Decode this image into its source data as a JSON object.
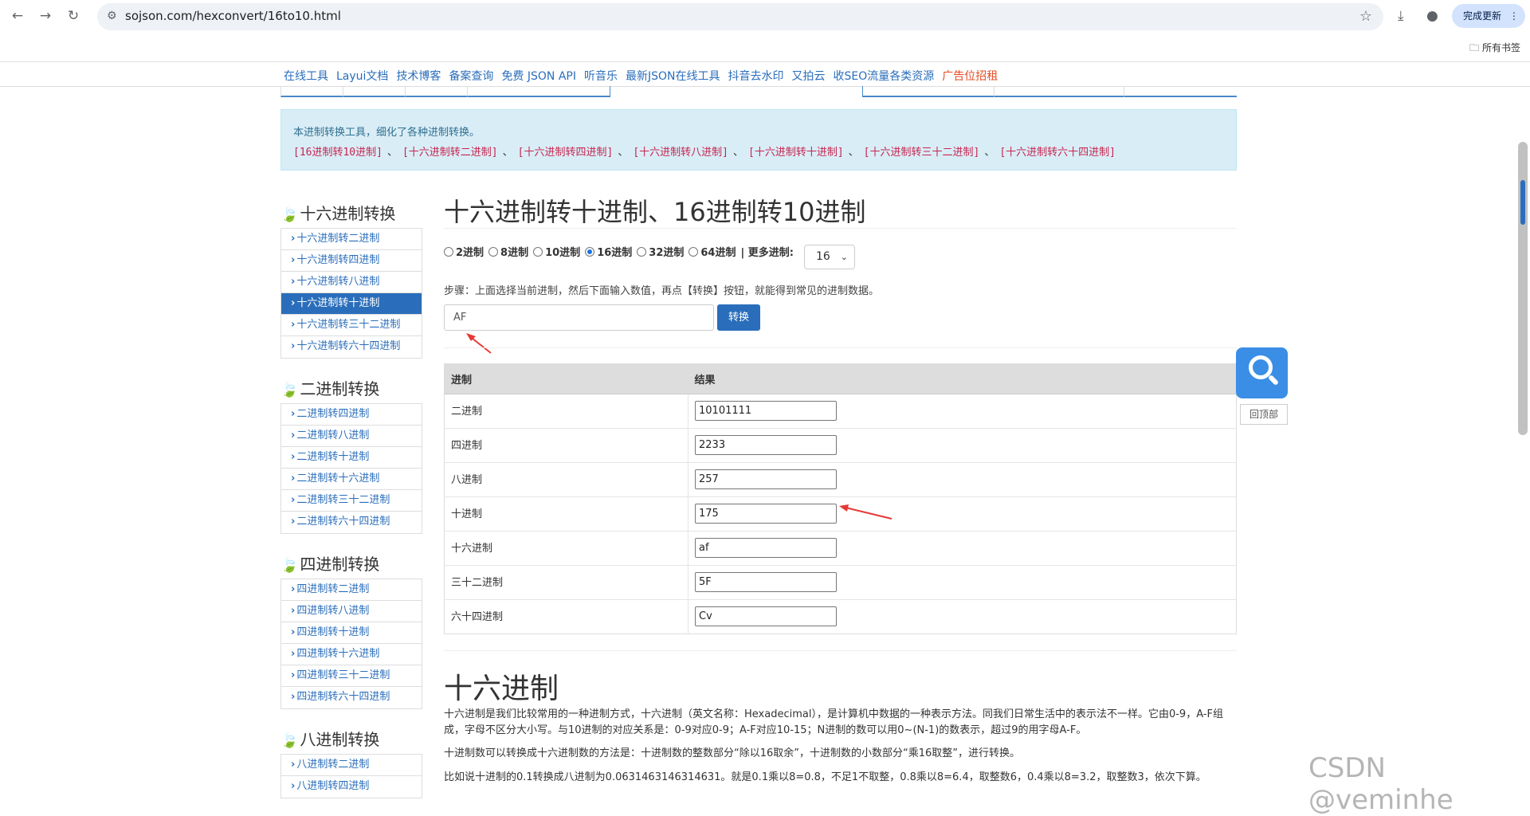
{
  "browser": {
    "url": "sojson.com/hexconvert/16to10.html",
    "update_label": "完成更新",
    "bookmarks_label": "所有书签"
  },
  "top_nav": {
    "links": [
      "在线工具",
      "Layui文档",
      "技术博客",
      "备案查询",
      "免费 JSON API",
      "听音乐",
      "最新JSON在线工具",
      "抖音去水印",
      "又拍云",
      "收SEO流量各类资源"
    ],
    "ad_link": "广告位招租"
  },
  "info": {
    "intro": "本进制转换工具，细化了各种进制转换。",
    "links": [
      "[16进制转10进制]",
      "[十六进制转二进制]",
      "[十六进制转四进制]",
      "[十六进制转八进制]",
      "[十六进制转十进制]",
      "[十六进制转三十二进制]",
      "[十六进制转六十四进制]"
    ],
    "separator": "、"
  },
  "sidebar": {
    "groups": [
      {
        "title": "十六进制转换",
        "items": [
          "十六进制转二进制",
          "十六进制转四进制",
          "十六进制转八进制",
          "十六进制转十进制",
          "十六进制转三十二进制",
          "十六进制转六十四进制"
        ],
        "active": 3
      },
      {
        "title": "二进制转换",
        "items": [
          "二进制转四进制",
          "二进制转八进制",
          "二进制转十进制",
          "二进制转十六进制",
          "二进制转三十二进制",
          "二进制转六十四进制"
        ],
        "active": -1
      },
      {
        "title": "四进制转换",
        "items": [
          "四进制转二进制",
          "四进制转八进制",
          "四进制转十进制",
          "四进制转十六进制",
          "四进制转三十二进制",
          "四进制转六十四进制"
        ],
        "active": -1
      },
      {
        "title": "八进制转换",
        "items": [
          "八进制转二进制",
          "八进制转四进制"
        ],
        "active": -1
      }
    ]
  },
  "main": {
    "title": "十六进制转十进制、16进制转10进制",
    "radios": [
      {
        "label": "2进制",
        "checked": false
      },
      {
        "label": "8进制",
        "checked": false
      },
      {
        "label": "10进制",
        "checked": false
      },
      {
        "label": "16进制",
        "checked": true
      },
      {
        "label": "32进制",
        "checked": false
      },
      {
        "label": "64进制",
        "checked": false
      }
    ],
    "more_label": "| 更多进制:",
    "more_value": "16",
    "steps": "步骤：上面选择当前进制，然后下面输入数值，再点【转换】按钮，就能得到常见的进制数据。",
    "input_value": "AF",
    "convert_label": "转换",
    "table": {
      "headers": [
        "进制",
        "结果"
      ],
      "rows": [
        {
          "base": "二进制",
          "value": "10101111"
        },
        {
          "base": "四进制",
          "value": "2233"
        },
        {
          "base": "八进制",
          "value": "257"
        },
        {
          "base": "十进制",
          "value": "175"
        },
        {
          "base": "十六进制",
          "value": "af"
        },
        {
          "base": "三十二进制",
          "value": "5F"
        },
        {
          "base": "六十四进制",
          "value": "Cv"
        }
      ]
    },
    "section_title": "十六进制",
    "paragraphs": [
      "十六进制是我们比较常用的一种进制方式，十六进制（英文名称：Hexadecimal），是计算机中数据的一种表示方法。同我们日常生活中的表示法不一样。它由0-9，A-F组成，字母不区分大小写。与10进制的对应关系是：0-9对应0-9；A-F对应10-15；N进制的数可以用0~(N-1)的数表示，超过9的用字母A-F。",
      "十进制数可以转换成十六进制数的方法是：十进制数的整数部分“除以16取余”，十进制数的小数部分“乘16取整”，进行转换。",
      "比如说十进制的0.1转换成八进制为0.0631463146314631。就是0.1乘以8=0.8，不足1不取整，0.8乘以8=6.4，取整数6，0.4乘以8=3.2，取整数3，依次下算。"
    ]
  },
  "floating": {
    "backtop_label": "回顶部"
  },
  "watermark": "CSDN @veminhe"
}
